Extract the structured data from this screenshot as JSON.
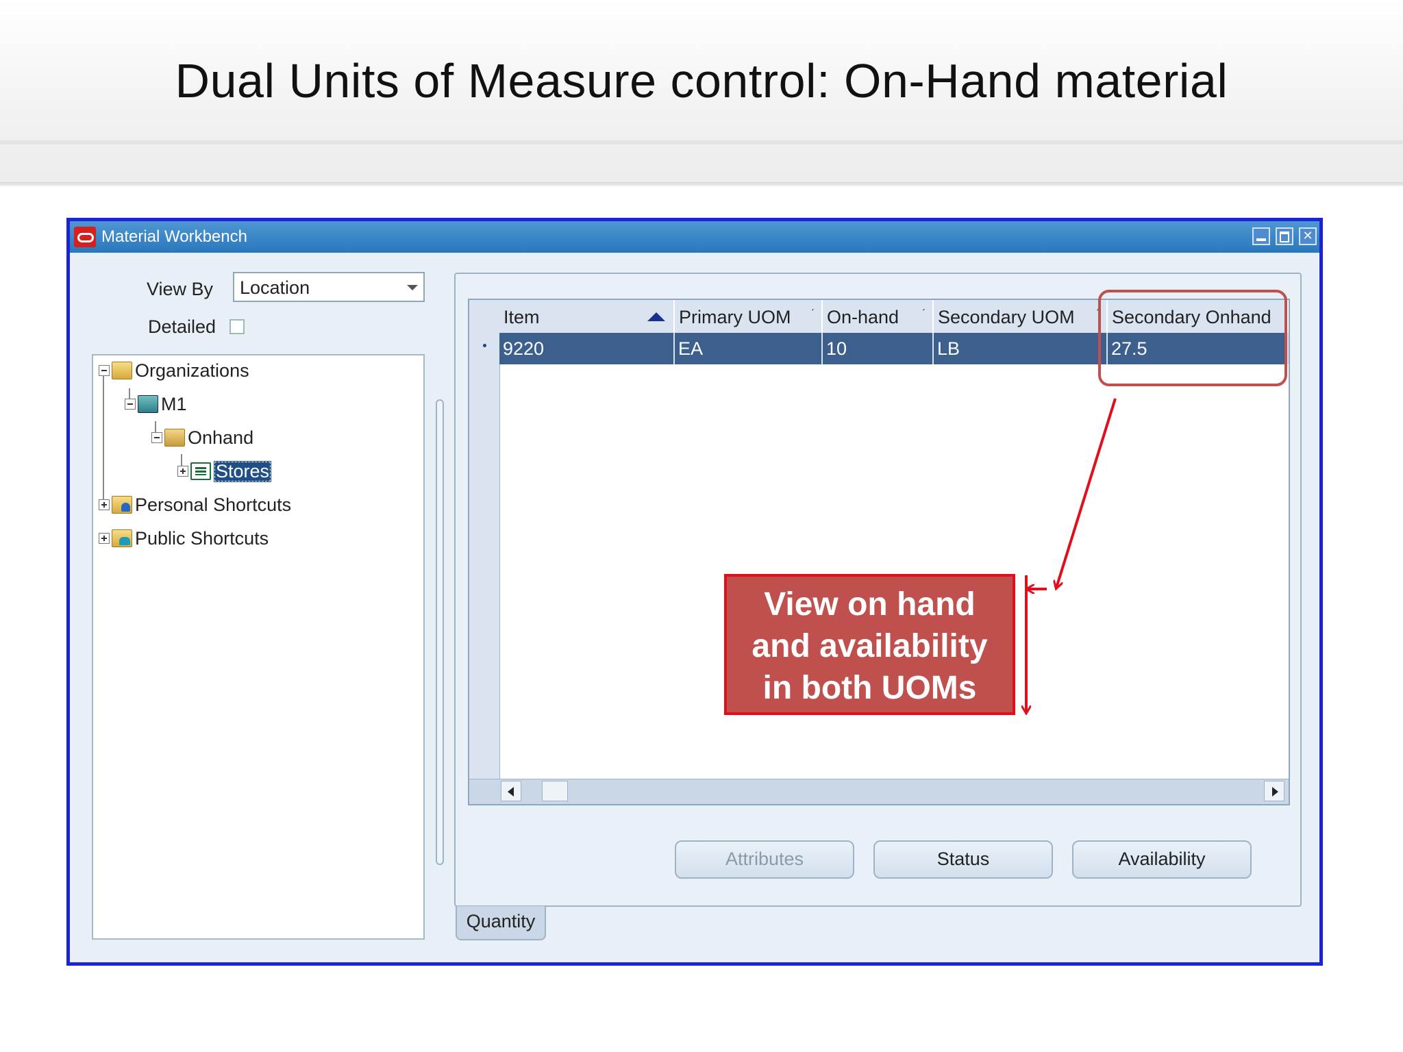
{
  "slide": {
    "title": "Dual Units of Measure control: On-Hand material"
  },
  "window": {
    "title": "Material Workbench"
  },
  "left_panel": {
    "view_by_label": "View By",
    "view_by_value": "Location",
    "detailed_label": "Detailed",
    "tree": [
      {
        "label": "Organizations",
        "icon": "folder-open-icon",
        "expanded": true
      },
      {
        "label": "M1",
        "icon": "organization-cube-icon",
        "expanded": true
      },
      {
        "label": "Onhand",
        "icon": "onhand-boxes-icon",
        "expanded": true
      },
      {
        "label": "Stores",
        "icon": "subinventory-list-icon",
        "selected": true
      },
      {
        "label": "Personal Shortcuts",
        "icon": "folder-person-icon",
        "expanded": false
      },
      {
        "label": "Public Shortcuts",
        "icon": "folder-group-icon",
        "expanded": false
      }
    ]
  },
  "grid": {
    "columns": [
      "Item",
      "Primary UOM",
      "On-hand",
      "Secondary UOM",
      "Secondary Onhand"
    ],
    "rows": [
      [
        "9220",
        "EA",
        "10",
        "LB",
        "27.5"
      ]
    ]
  },
  "buttons": {
    "attributes": "Attributes",
    "status": "Status",
    "availability": "Availability"
  },
  "tabs": {
    "quantity": "Quantity"
  },
  "annotation": {
    "line1": "View on hand",
    "line2": "and availability",
    "line3": "in both UOMs"
  },
  "colors": {
    "window_border": "#1a24d6",
    "titlebar": "#2a77bd",
    "selected_row": "#3d5f8e",
    "callout_fill": "#c0504d",
    "callout_border": "#e10e1c"
  }
}
